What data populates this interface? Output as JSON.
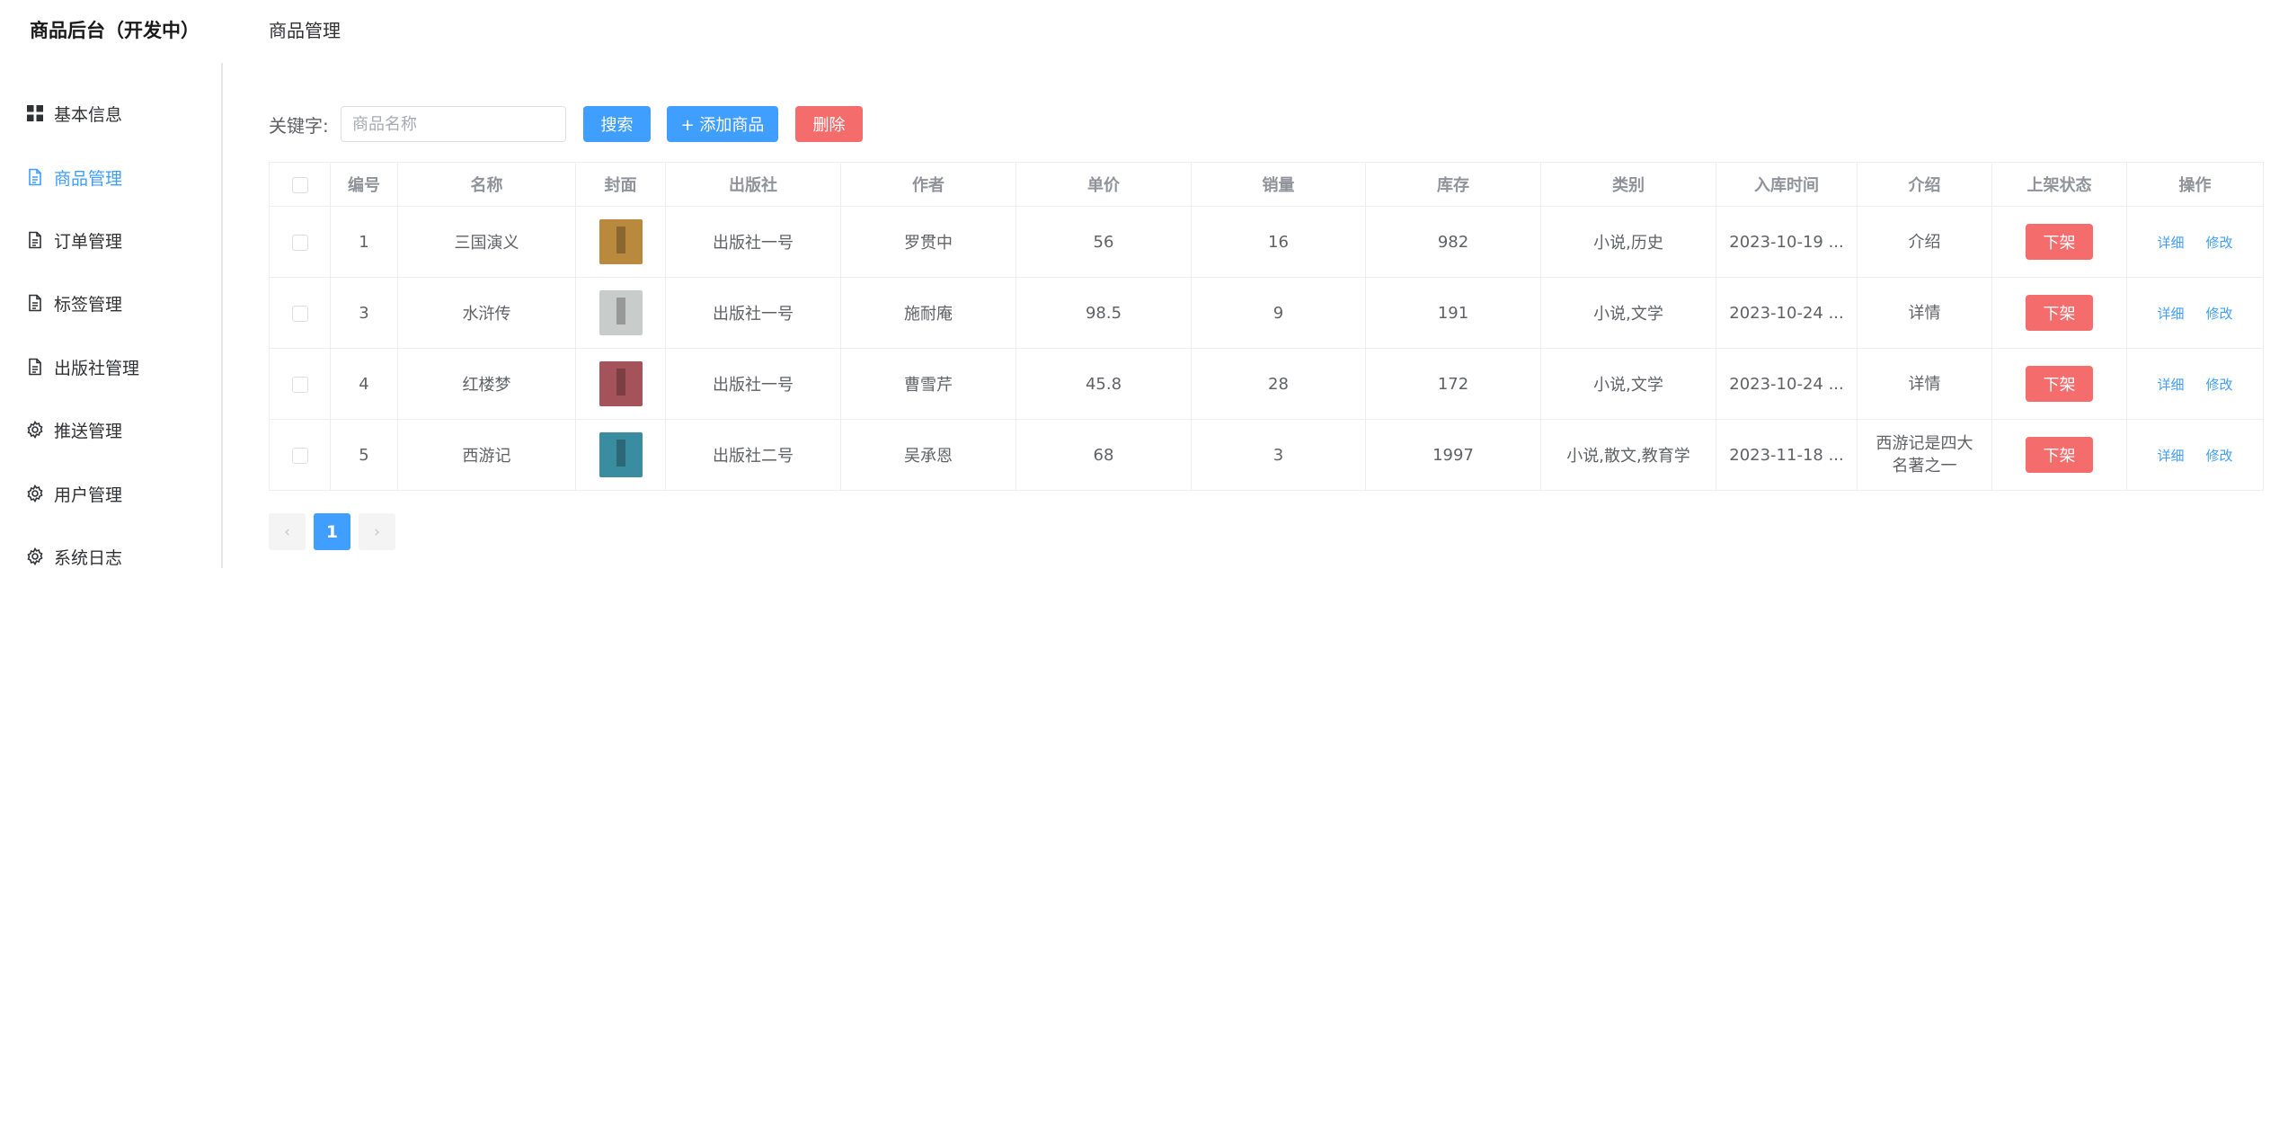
{
  "app": {
    "title": "商品后台（开发中）"
  },
  "header": {
    "title": "商品管理"
  },
  "sidebar": {
    "items": [
      {
        "label": "基本信息",
        "icon": "grid-icon",
        "active": false
      },
      {
        "label": "商品管理",
        "icon": "document-icon",
        "active": true
      },
      {
        "label": "订单管理",
        "icon": "document-icon",
        "active": false
      },
      {
        "label": "标签管理",
        "icon": "document-icon",
        "active": false
      },
      {
        "label": "出版社管理",
        "icon": "document-icon",
        "active": false
      },
      {
        "label": "推送管理",
        "icon": "gear-icon",
        "active": false
      },
      {
        "label": "用户管理",
        "icon": "gear-icon",
        "active": false
      },
      {
        "label": "系统日志",
        "icon": "gear-icon",
        "active": false
      }
    ]
  },
  "toolbar": {
    "keyword_label": "关键字:",
    "search_placeholder": "商品名称",
    "search_label": "搜索",
    "add_label": "+ 添加商品",
    "delete_label": "删除"
  },
  "table": {
    "columns": [
      "编号",
      "名称",
      "封面",
      "出版社",
      "作者",
      "单价",
      "销量",
      "库存",
      "类别",
      "入库时间",
      "介绍",
      "上架状态",
      "操作"
    ],
    "rows": [
      {
        "id": "1",
        "name": "三国演义",
        "cover_color": "#b98a3e",
        "publisher": "出版社一号",
        "author": "罗贯中",
        "price": "56",
        "sales": "16",
        "stock": "982",
        "category": "小说,历史",
        "date": "2023-10-19 ...",
        "intro": "介绍",
        "status": "下架",
        "detail": "详细",
        "edit": "修改"
      },
      {
        "id": "3",
        "name": "水浒传",
        "cover_color": "#c8cccb",
        "publisher": "出版社一号",
        "author": "施耐庵",
        "price": "98.5",
        "sales": "9",
        "stock": "191",
        "category": "小说,文学",
        "date": "2023-10-24 ...",
        "intro": "详情",
        "status": "下架",
        "detail": "详细",
        "edit": "修改"
      },
      {
        "id": "4",
        "name": "红楼梦",
        "cover_color": "#a5535a",
        "publisher": "出版社一号",
        "author": "曹雪芹",
        "price": "45.8",
        "sales": "28",
        "stock": "172",
        "category": "小说,文学",
        "date": "2023-10-24 ...",
        "intro": "详情",
        "status": "下架",
        "detail": "详细",
        "edit": "修改"
      },
      {
        "id": "5",
        "name": "西游记",
        "cover_color": "#3a8ca1",
        "publisher": "出版社二号",
        "author": "吴承恩",
        "price": "68",
        "sales": "3",
        "stock": "1997",
        "category": "小说,散文,教育学",
        "date": "2023-11-18 ...",
        "intro": "西游记是四大名著之一",
        "status": "下架",
        "detail": "详细",
        "edit": "修改"
      }
    ]
  },
  "pagination": {
    "prev": "‹",
    "current_page": "1",
    "next": "›"
  },
  "colors": {
    "primary": "#409eff",
    "danger": "#f56c6c"
  }
}
